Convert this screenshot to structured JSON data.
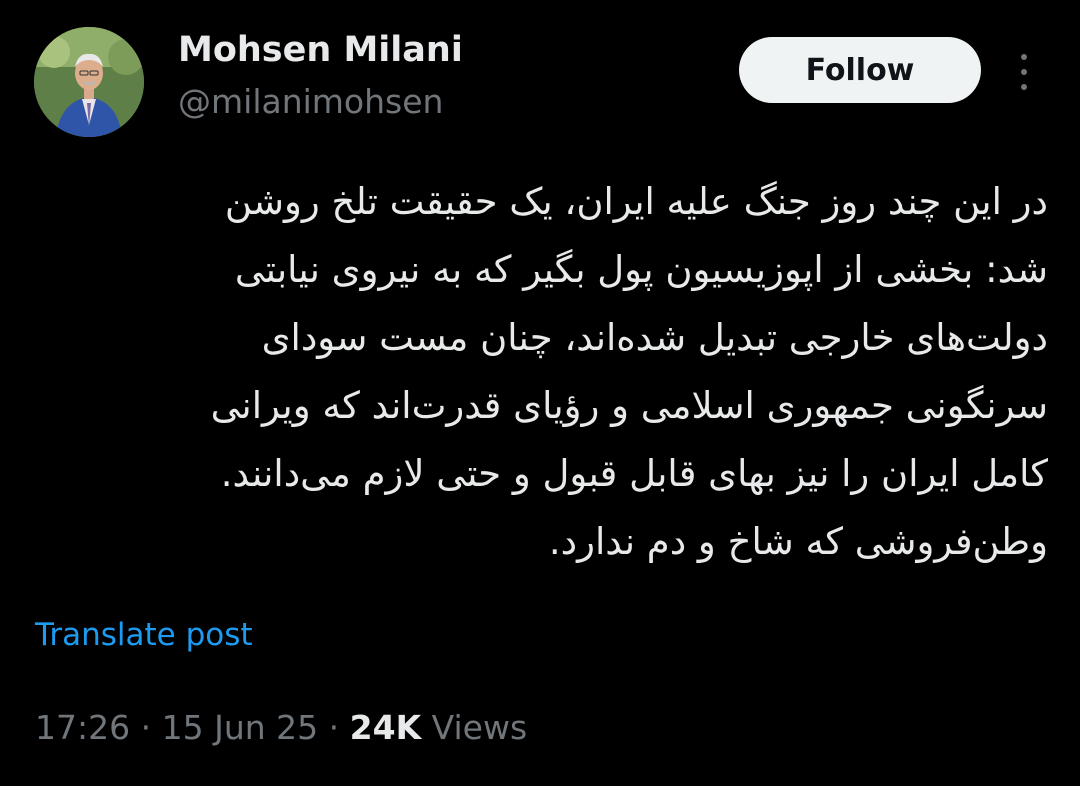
{
  "author": {
    "name": "Mohsen Milani",
    "handle": "@milanimohsen"
  },
  "follow_button": {
    "label": "Follow"
  },
  "more_menu": {
    "icon": "more-vertical-icon"
  },
  "tweet": {
    "lines": [
      "در این چند روز جنگ علیه ایران، یک حقیقت تلخ روشن",
      "شد: بخشی از اپوزیسیون پول بگیر که به نیروی نیابتی",
      "دولت‌های خارجی تبدیل شده‌اند، چنان مست سودای",
      "سرنگونی جمهوری اسلامی و رؤیای قدرت‌اند که ویرانی",
      "کامل ایران را نیز بهای قابل قبول و حتی لازم می‌دانند.",
      "وطن‌فروشی که شاخ و دم ندارد."
    ]
  },
  "translate": {
    "label": "Translate post"
  },
  "meta": {
    "time": "17:26",
    "separator": "·",
    "date": "15 Jun 25",
    "views_count": "24K",
    "views_label": "Views"
  },
  "colors": {
    "background": "#000000",
    "primary_text": "#e7e9ea",
    "secondary_text": "#71767b",
    "link": "#1d9bf0",
    "follow_bg": "#eff3f4"
  }
}
